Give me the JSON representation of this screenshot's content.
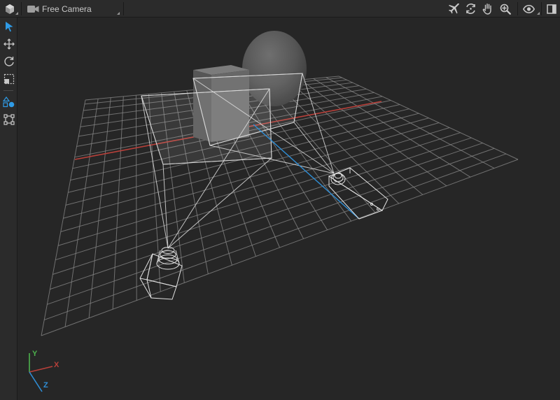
{
  "topbar": {
    "camera_mode": "Free Camera",
    "left_icon": "cube-icon",
    "right_icons": [
      "fly-icon",
      "orbit-icon",
      "pan-hand-icon",
      "zoom-icon",
      "visibility-eye-icon",
      "panel-toggle-icon"
    ]
  },
  "toolbar": {
    "tools": [
      "select-arrow-icon",
      "move-icon",
      "rotate-icon",
      "scale-icon",
      "shapes-icon",
      "bounding-box-icon"
    ],
    "active_tool": "select-arrow-icon"
  },
  "gizmo": {
    "x": "X",
    "y": "Y",
    "z": "Z"
  },
  "colors": {
    "background": "#262626",
    "grid": "#8c8c8c",
    "x_axis": "#b8403a",
    "z_axis": "#2f8ed6",
    "y_axis": "#4cb04c",
    "accent": "#2f9be6"
  }
}
